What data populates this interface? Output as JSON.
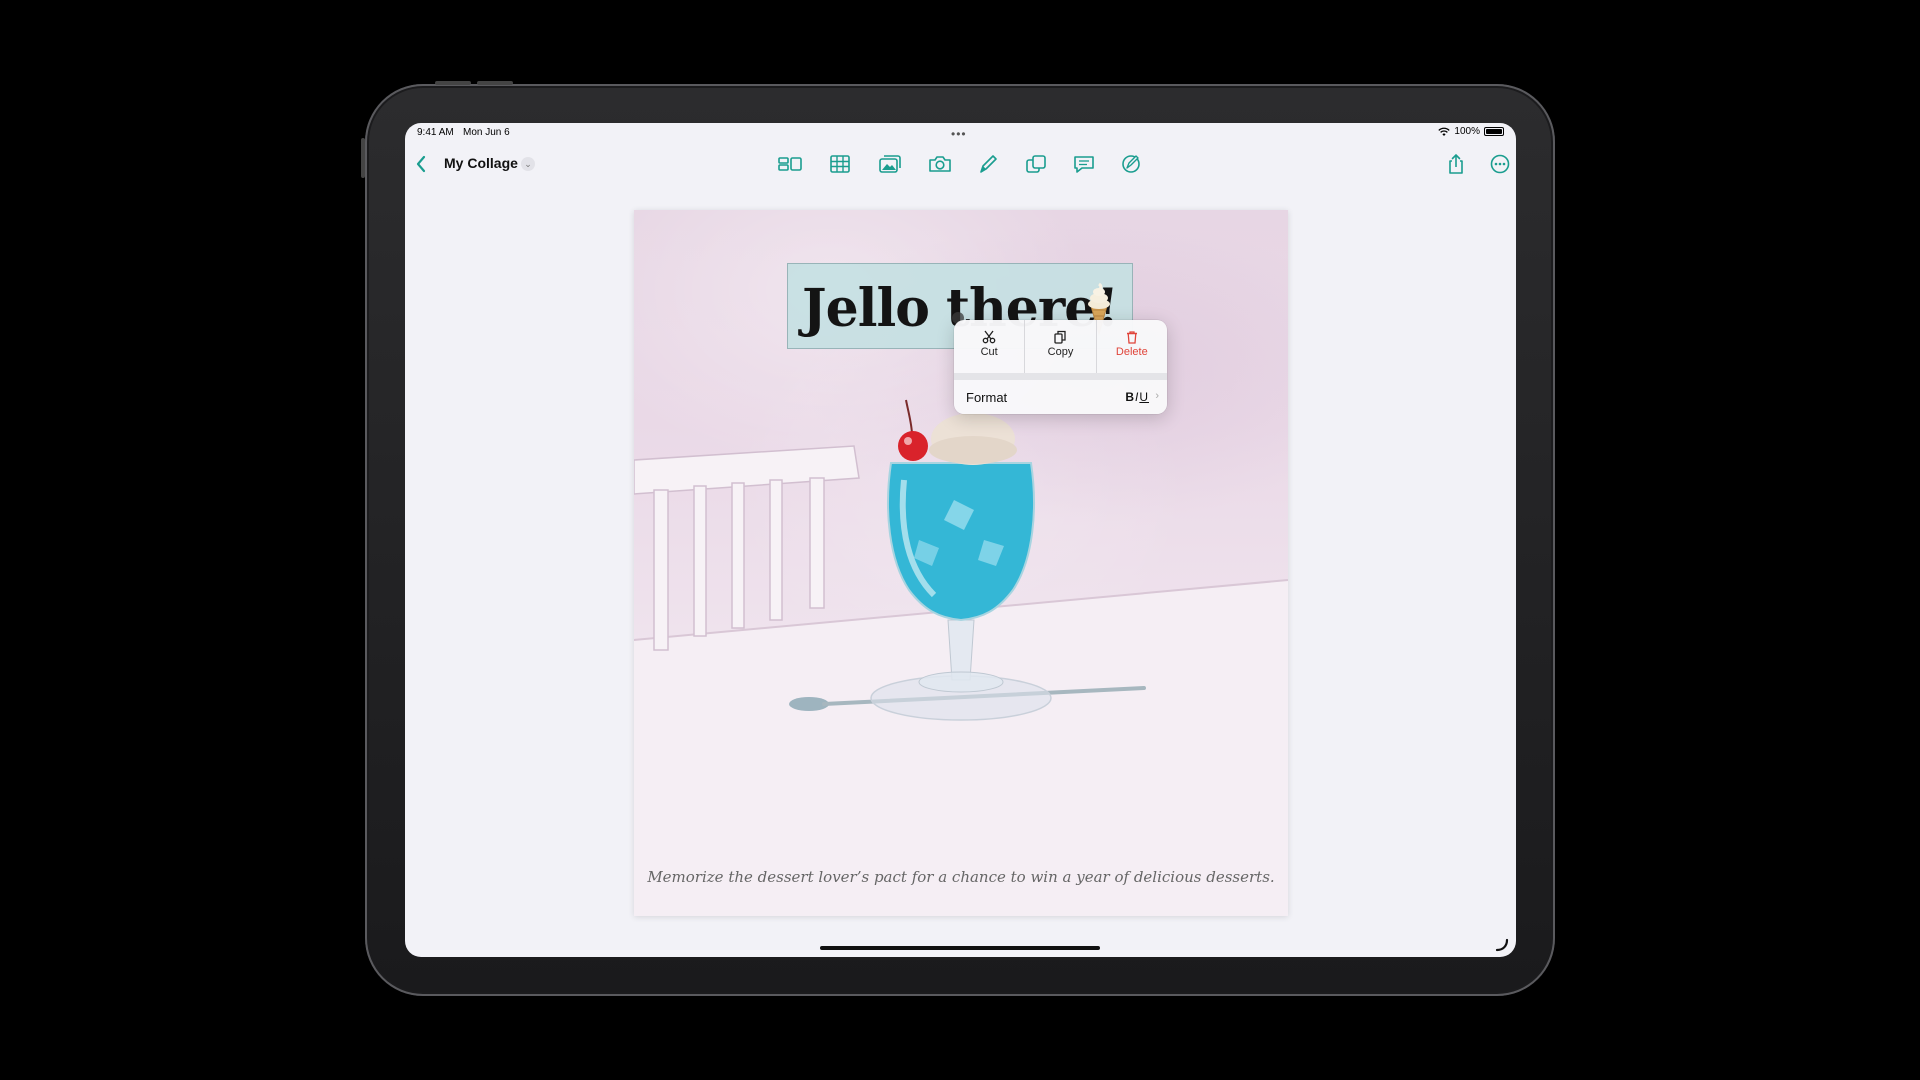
{
  "status_bar": {
    "time": "9:41 AM",
    "date": "Mon Jun 6",
    "multitask": "•••",
    "battery": "100%"
  },
  "toolbar": {
    "doc_title": "My Collage",
    "title_chevron": "⌄",
    "tools": [
      "sidebar-view-icon",
      "table-icon",
      "media-icon",
      "camera-icon",
      "pencil-icon",
      "shapes-icon",
      "comment-icon",
      "markup-icon"
    ],
    "right_tools": [
      "share-icon",
      "more-icon"
    ],
    "accent_color": "#1a9d8f"
  },
  "canvas": {
    "title": "Jello there!",
    "caption": "Memorize the dessert lover’s pact for a chance to win a year of delicious desserts."
  },
  "context_menu": {
    "cut": "Cut",
    "copy": "Copy",
    "delete": "Delete",
    "format": "Format",
    "format_styles": "BIU",
    "format_chevron": "›"
  }
}
